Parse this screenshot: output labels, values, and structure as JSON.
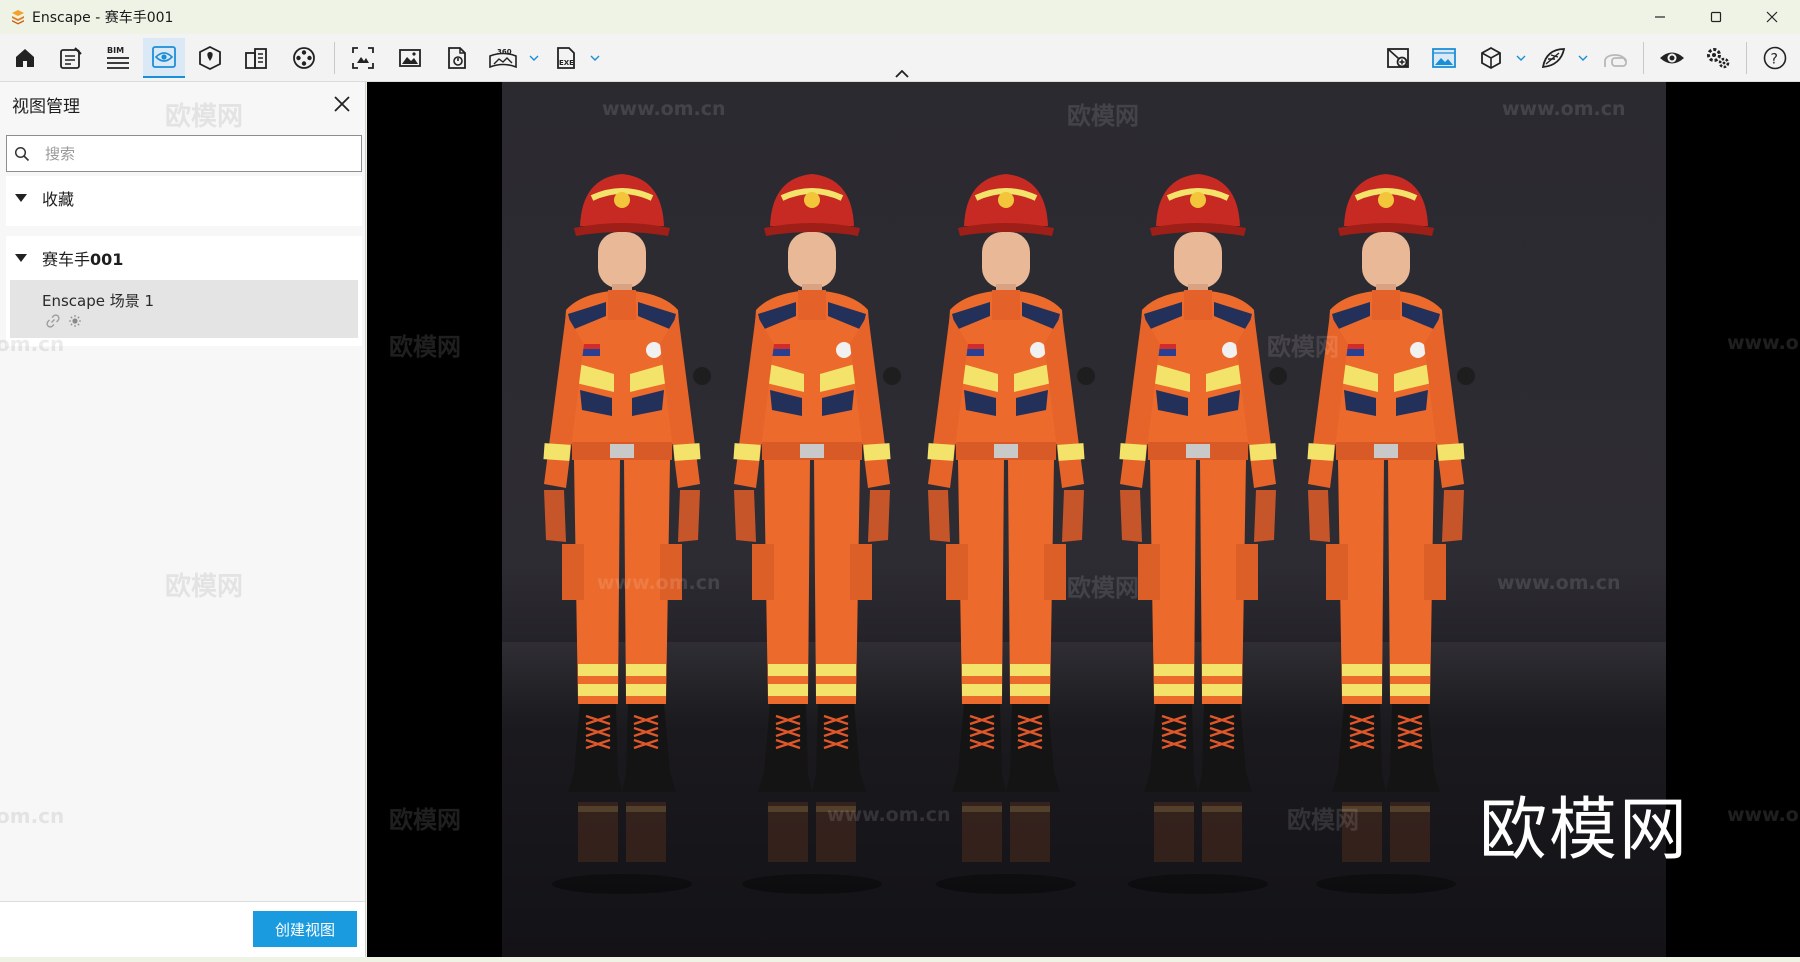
{
  "window": {
    "title": "Enscape - 赛车手001",
    "controls": [
      "minimize-icon",
      "maximize-icon",
      "close-icon"
    ]
  },
  "toolbar": {
    "left_icons": [
      "home-icon",
      "notes-icon",
      "bim-icon",
      "views-icon",
      "site-context-icon",
      "buildings-icon",
      "video-editor-icon",
      "screenshot-icon",
      "image-export-icon",
      "batch-export-icon",
      "panorama-360-icon",
      "exe-export-icon"
    ],
    "bim_label": "BIM",
    "panorama_label": "360",
    "exe_label": "EXE",
    "right_icons": [
      "asset-library-icon",
      "image-icon",
      "cube-icon",
      "material-icon",
      "vr-headset-icon",
      "visual-settings-icon",
      "settings-icon",
      "help-icon"
    ],
    "active_tool": "views-icon"
  },
  "panel": {
    "title": "视图管理",
    "search_placeholder": "搜索",
    "sections": [
      {
        "label": "收藏",
        "expanded": true,
        "items": []
      },
      {
        "label_prefix": "赛车手",
        "label_bold": "001",
        "expanded": true,
        "items": [
          {
            "name": "Enscape 场景 1",
            "icons": [
              "link-icon",
              "sun-icon"
            ]
          }
        ]
      }
    ],
    "create_button": "创建视图",
    "watermarks": [
      "欧模网",
      "欧模网",
      "om.cn",
      "om.cn"
    ]
  },
  "viewport": {
    "watermark_text": "欧模网",
    "watermark_url": "www.om.cn",
    "brand_mark": "欧模网",
    "figure_count": 5
  },
  "colors": {
    "accent": "#1a9be0",
    "suit": "#ec6a2c",
    "helmet": "#c72a22",
    "reflective": "#f3e36a"
  }
}
